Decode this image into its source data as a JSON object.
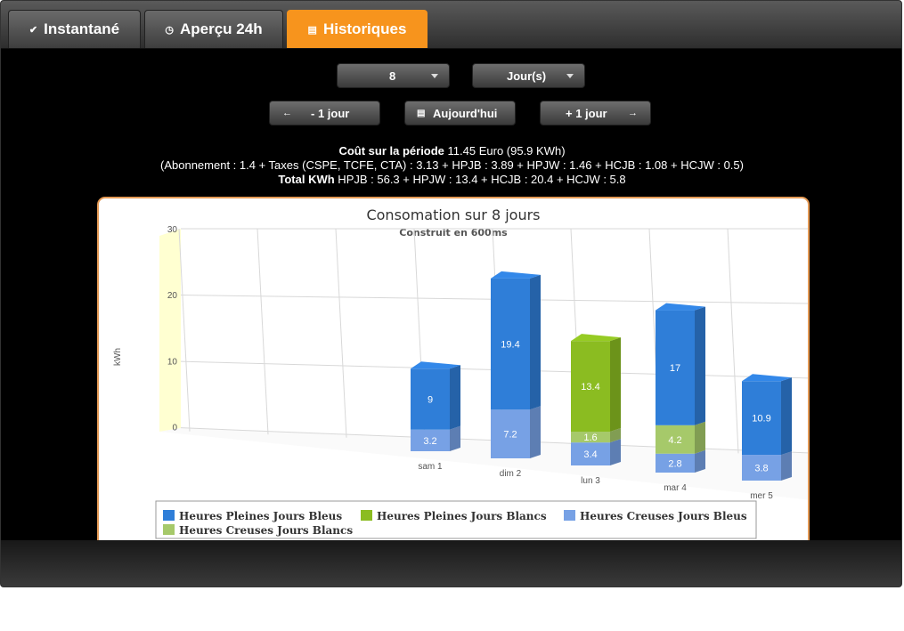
{
  "tabs": [
    {
      "label": "Instantané",
      "icon": "check-icon",
      "glyph": "✔"
    },
    {
      "label": "Aperçu 24h",
      "icon": "clock-icon",
      "glyph": "◷"
    },
    {
      "label": "Historiques",
      "icon": "calendar-icon",
      "glyph": "▤"
    }
  ],
  "period": {
    "count_value": "8",
    "unit_value": "Jour(s)"
  },
  "nav": {
    "prev_label": "- 1 jour",
    "prev_glyph": "←",
    "today_label": "Aujourd'hui",
    "today_glyph": "▤",
    "next_label": "+ 1 jour",
    "next_glyph": "→"
  },
  "summary": {
    "cost_label": "Coût sur la période",
    "cost_value": " 11.45 Euro (95.9 KWh)",
    "detail_line": "(Abonnement : 1.4 + Taxes (CSPE, TCFE, CTA) : 3.13 + HPJB : 3.89 + HPJW : 1.46 + HCJB : 1.08 + HCJW : 0.5)",
    "total_label": "Total KWh",
    "total_value": " HPJB : 56.3 + HPJW : 13.4 + HCJB : 20.4 + HCJW : 5.8"
  },
  "chart_data": {
    "type": "bar",
    "stacked": true,
    "three_d": true,
    "title": "Consomation sur 8 jours",
    "subtitle": "Construit en 600ms",
    "ylabel": "kWh",
    "ylim": [
      0,
      30
    ],
    "yticks": [
      0,
      10,
      20,
      30
    ],
    "grid": true,
    "legend_position": "bottom",
    "categories": [
      "sam 1",
      "dim 2",
      "lun 3",
      "mar 4",
      "mer 5"
    ],
    "series": [
      {
        "name": "Heures Pleines Jours Bleus",
        "color": "#2f7ed8",
        "values": [
          9,
          19.4,
          0,
          17,
          10.9
        ]
      },
      {
        "name": "Heures Pleines Jours Blancs",
        "color": "#8bbc21",
        "values": [
          0,
          0,
          13.4,
          0,
          0
        ]
      },
      {
        "name": "Heures Creuses Jours Bleus",
        "color": "#77a1e5",
        "values": [
          3.2,
          7.2,
          3.4,
          2.8,
          3.8
        ]
      },
      {
        "name": "Heures Creuses Jours Blancs",
        "color": "#a6c96a",
        "values": [
          0,
          0,
          1.6,
          4.2,
          0
        ]
      }
    ]
  }
}
